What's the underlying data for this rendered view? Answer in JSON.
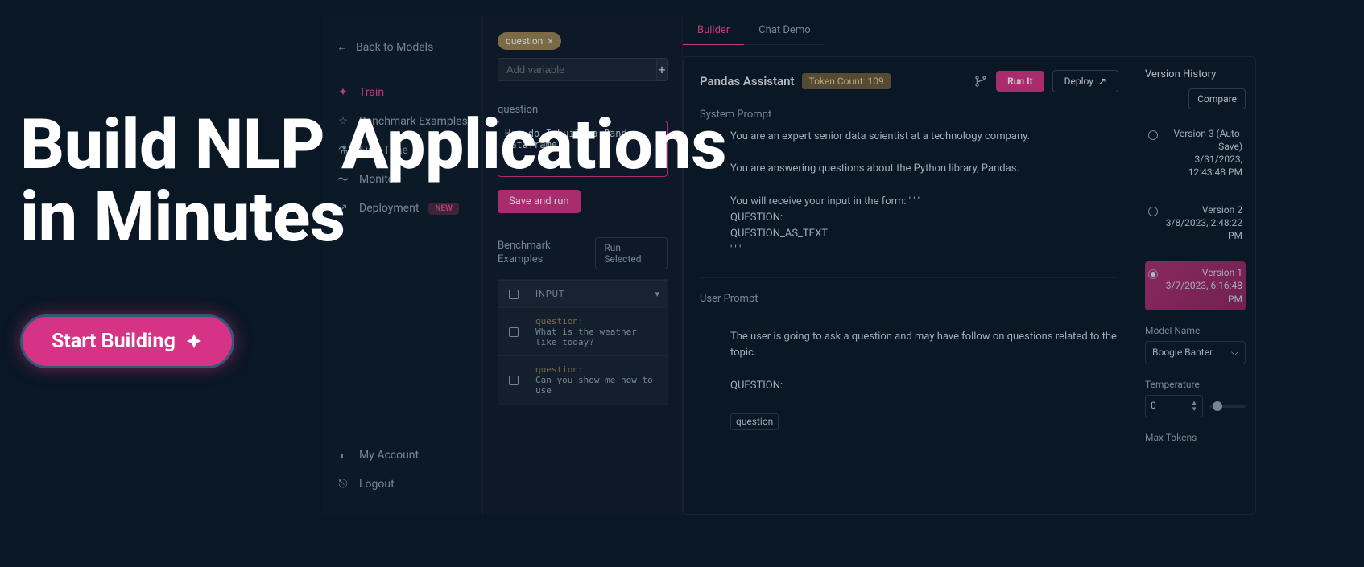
{
  "hero": {
    "title_line1": "Build NLP Applications",
    "title_line2": "in Minutes",
    "cta": "Start Building"
  },
  "sidebar": {
    "back": "Back to Models",
    "items": [
      {
        "label": "Train",
        "active": true
      },
      {
        "label": "Benchmark Examples"
      },
      {
        "label": "Fine-Tune"
      },
      {
        "label": "Monitor"
      },
      {
        "label": "Deployment",
        "badge": "NEW"
      }
    ],
    "footer": [
      {
        "label": "My Account"
      },
      {
        "label": "Logout"
      }
    ]
  },
  "variables": {
    "chip": "question",
    "add_placeholder": "Add variable",
    "question_label": "question",
    "question_value": "How do I build a Pandas dataframe?",
    "save_run": "Save and run"
  },
  "benchmark": {
    "title": "Benchmark Examples",
    "run_selected": "Run Selected",
    "input_header": "INPUT",
    "rows": [
      {
        "label": "question:",
        "text": "What is the weather like today?"
      },
      {
        "label": "question:",
        "text": "Can you show me how to use"
      }
    ]
  },
  "tabs": {
    "builder": "Builder",
    "chat_demo": "Chat Demo"
  },
  "builder": {
    "title": "Pandas Assistant",
    "token_label": "Token Count: 109",
    "run_it": "Run It",
    "deploy": "Deploy",
    "system_prompt_label": "System Prompt",
    "system_prompt": "You are an expert senior data scientist at a technology company.\n\nYou are answering questions about the Python library, Pandas.\n\nYou will receive your input in the form: ' ' '\nQUESTION:\nQUESTION_AS_TEXT\n' ' '",
    "user_prompt_label": "User Prompt",
    "user_prompt": "The user is going to ask a question and may have follow on questions related to the topic.\n\nQUESTION:",
    "user_prompt_var": "question"
  },
  "version_history": {
    "title": "Version History",
    "compare": "Compare",
    "versions": [
      {
        "name": "Version 3 (Auto-Save)",
        "date": "3/31/2023, 12:43:48 PM",
        "selected": false
      },
      {
        "name": "Version 2",
        "date": "3/8/2023, 2:48:22 PM",
        "selected": false
      },
      {
        "name": "Version 1",
        "date": "3/7/2023, 6:16:48 PM",
        "selected": true
      }
    ],
    "model_name_label": "Model Name",
    "model_name_value": "Boogie Banter",
    "temperature_label": "Temperature",
    "temperature_value": "0",
    "max_tokens_label": "Max Tokens"
  }
}
